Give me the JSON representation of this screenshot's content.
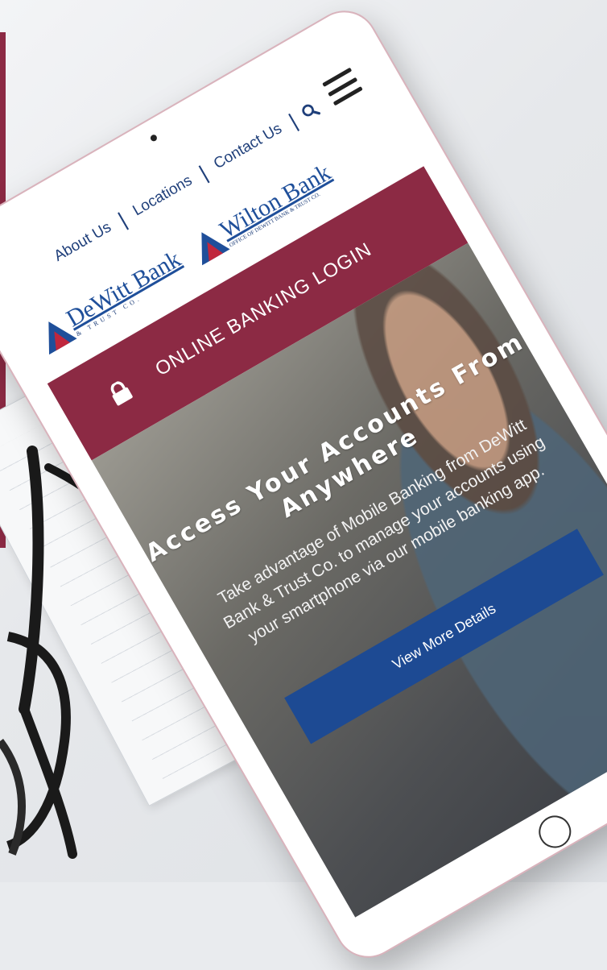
{
  "colors": {
    "brand_maroon": "#8c2a44",
    "brand_blue": "#1d4a93",
    "logo_blue": "#1f4f9a"
  },
  "nav": {
    "about": "About Us",
    "locations": "Locations",
    "contact": "Contact Us",
    "search_icon": "search-icon",
    "menu_icon": "hamburger-menu-icon"
  },
  "logos": {
    "dewitt_name": "DeWitt Bank",
    "dewitt_sub": "& TRUST CO.",
    "wilton_name": "Wilton Bank",
    "wilton_sub": "OFFICE OF DEWITT BANK & TRUST CO."
  },
  "login": {
    "icon": "lock-icon",
    "label": "ONLINE BANKING LOGIN"
  },
  "hero": {
    "title": "Access Your Accounts From Anywhere",
    "body": "Take advantage of Mobile Banking from DeWitt Bank & Trust Co. to manage your accounts using your smartphone via our mobile banking app.",
    "cta": "View More Details"
  }
}
